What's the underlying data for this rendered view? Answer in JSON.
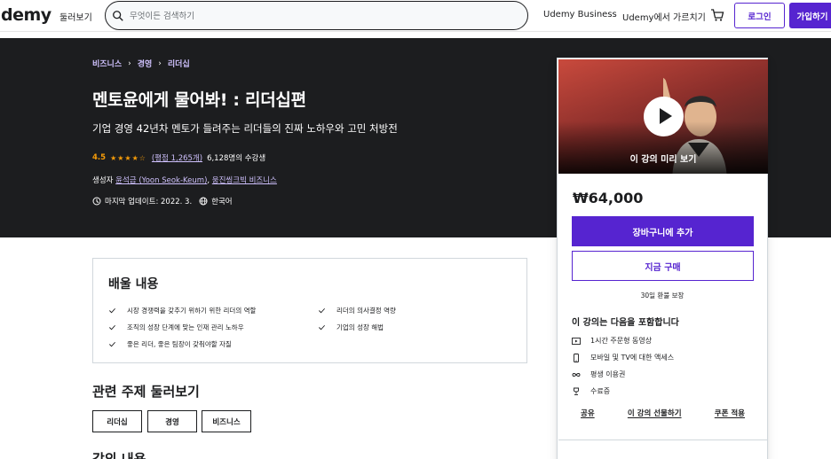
{
  "header": {
    "logo": "demy",
    "browse": "둘러보기",
    "search_placeholder": "무엇이든 검색하기",
    "business": "Udemy Business",
    "teach": "Udemy에서 가르치기",
    "login": "로그인",
    "signup": "가입하기"
  },
  "breadcrumb": [
    "비즈니스",
    "경영",
    "리더십"
  ],
  "course": {
    "title": "멘토윤에게 물어봐! : 리더십편",
    "subtitle": "기업 경영 42년차 멘토가 들려주는 리더들의 진짜 노하우와 고민 처방전",
    "rating": "4.5",
    "rating_value": 4.5,
    "rating_count": "(평점 1,265개)",
    "students": "6,128명의 수강생",
    "creator_label": "생성자",
    "creator_1": "윤석금 (Yoon Seok-Keum)",
    "creator_sep": ", ",
    "creator_2": "웅진씽크빅 비즈니스",
    "updated": "마지막 업데이트: 2022. 3.",
    "language": "한국어"
  },
  "card": {
    "preview_label": "이 강의 미리 보기",
    "price": "₩64,000",
    "add_to_cart": "장바구니에 추가",
    "buy_now": "지금 구매",
    "refund": "30일 환불 보장",
    "includes_title": "이 강의는 다음을 포함합니다",
    "includes": [
      {
        "icon": "video-icon",
        "label": "1시간 주문형 동영상"
      },
      {
        "icon": "mobile-icon",
        "label": "모바일 및 TV에 대한 액세스"
      },
      {
        "icon": "infinity-icon",
        "label": "평생 이용권"
      },
      {
        "icon": "trophy-icon",
        "label": "수료증"
      }
    ],
    "share": "공유",
    "gift": "이 강의 선물하기",
    "coupon": "쿠폰 적용"
  },
  "learn": {
    "title": "배울 내용",
    "items": [
      "시장 경쟁력을 갖추기 위하기 위한 리더의 역할",
      "리더의 의사결정 역량",
      "조직의 성장 단계에 맞는 인재 관리 노하우",
      "기업의 성장 해법",
      "좋은 리더, 좋은 팀장이 갖춰야할 자질"
    ]
  },
  "topics": {
    "title": "관련 주제 둘러보기",
    "items": [
      "리더십",
      "경영",
      "비즈니스"
    ]
  },
  "content": {
    "title": "강의 내용"
  },
  "colors": {
    "accent": "#5624d0",
    "dark_banner": "#1c1d1f",
    "star": "#f69c08",
    "link_light": "#cec0fc"
  }
}
